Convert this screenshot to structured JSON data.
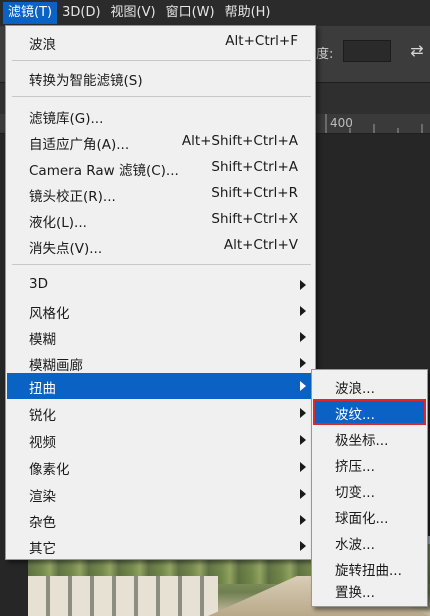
{
  "menubar": {
    "items": [
      "滤镜(T)",
      "3D(D)",
      "视图(V)",
      "窗口(W)",
      "帮助(H)"
    ],
    "active_index": 0
  },
  "options_bar": {
    "label": "度:",
    "swap_icon": "swap-arrows-icon"
  },
  "ruler": {
    "label": "400"
  },
  "filter_menu": {
    "items": [
      {
        "label": "波浪",
        "shortcut": "Alt+Ctrl+F"
      },
      {
        "label": "转换为智能滤镜(S)",
        "shortcut": ""
      },
      {
        "label": "滤镜库(G)...",
        "shortcut": ""
      },
      {
        "label": "自适应广角(A)...",
        "shortcut": "Alt+Shift+Ctrl+A"
      },
      {
        "label": "Camera Raw 滤镜(C)...",
        "shortcut": "Shift+Ctrl+A"
      },
      {
        "label": "镜头校正(R)...",
        "shortcut": "Shift+Ctrl+R"
      },
      {
        "label": "液化(L)...",
        "shortcut": "Shift+Ctrl+X"
      },
      {
        "label": "消失点(V)...",
        "shortcut": "Alt+Ctrl+V"
      },
      {
        "label": "3D",
        "shortcut": "",
        "submenu": true
      },
      {
        "label": "风格化",
        "shortcut": "",
        "submenu": true
      },
      {
        "label": "模糊",
        "shortcut": "",
        "submenu": true
      },
      {
        "label": "模糊画廊",
        "shortcut": "",
        "submenu": true
      },
      {
        "label": "扭曲",
        "shortcut": "",
        "submenu": true,
        "highlighted": true
      },
      {
        "label": "锐化",
        "shortcut": "",
        "submenu": true
      },
      {
        "label": "视频",
        "shortcut": "",
        "submenu": true
      },
      {
        "label": "像素化",
        "shortcut": "",
        "submenu": true
      },
      {
        "label": "渲染",
        "shortcut": "",
        "submenu": true
      },
      {
        "label": "杂色",
        "shortcut": "",
        "submenu": true
      },
      {
        "label": "其它",
        "shortcut": "",
        "submenu": true
      }
    ]
  },
  "distort_submenu": {
    "items": [
      "波浪...",
      "波纹...",
      "极坐标...",
      "挤压...",
      "切变...",
      "球面化...",
      "水波...",
      "旋转扭曲...",
      "置换..."
    ],
    "selected_index": 1
  },
  "colors": {
    "highlight": "#0a62c4",
    "selection_border": "#d9292c",
    "menu_bg": "#f0f0f0"
  }
}
